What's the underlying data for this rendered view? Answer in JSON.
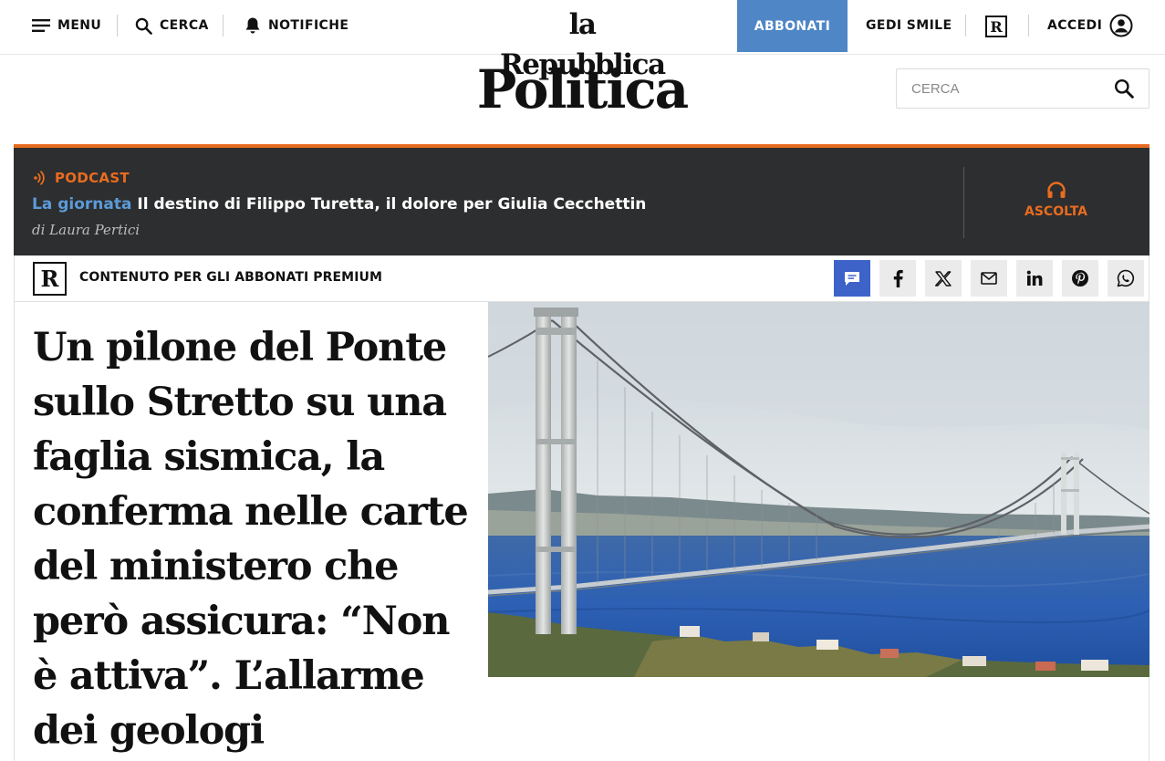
{
  "topbar": {
    "menu_label": "MENU",
    "search_label": "CERCA",
    "notifications_label": "NOTIFICHE",
    "logo": "la Repubblica",
    "subscribe_label": "ABBONATI",
    "gedi_label": "GEDI SMILE",
    "r_badge": "R",
    "login_label": "ACCEDI"
  },
  "section": {
    "title": "Politica",
    "search_placeholder": "CERCA"
  },
  "podcast": {
    "tag": "PODCAST",
    "series": "La giornata",
    "episode_title": "Il destino di Filippo Turetta, il dolore per Giulia Cecchettin",
    "author": "di Laura Pertici",
    "listen_label": "ASCOLTA"
  },
  "premium": {
    "r_badge": "R",
    "label": "CONTENUTO PER GLI ABBONATI PREMIUM",
    "share_icons": [
      "comments-icon",
      "facebook-icon",
      "x-icon",
      "email-icon",
      "linkedin-icon",
      "pinterest-icon",
      "whatsapp-icon"
    ]
  },
  "article": {
    "headline": "Un pilone del Ponte sullo Stretto su una faglia sismica, la conferma nelle carte del ministero che però assicura: “Non è attiva”. L’allarme dei geologi"
  },
  "colors": {
    "subscribe_bg": "#4f86c6",
    "podcast_accent": "#e86c20",
    "podcast_bg": "#2d2e2f",
    "series_link": "#5b9bd9",
    "comments_button": "#3d63c9"
  }
}
